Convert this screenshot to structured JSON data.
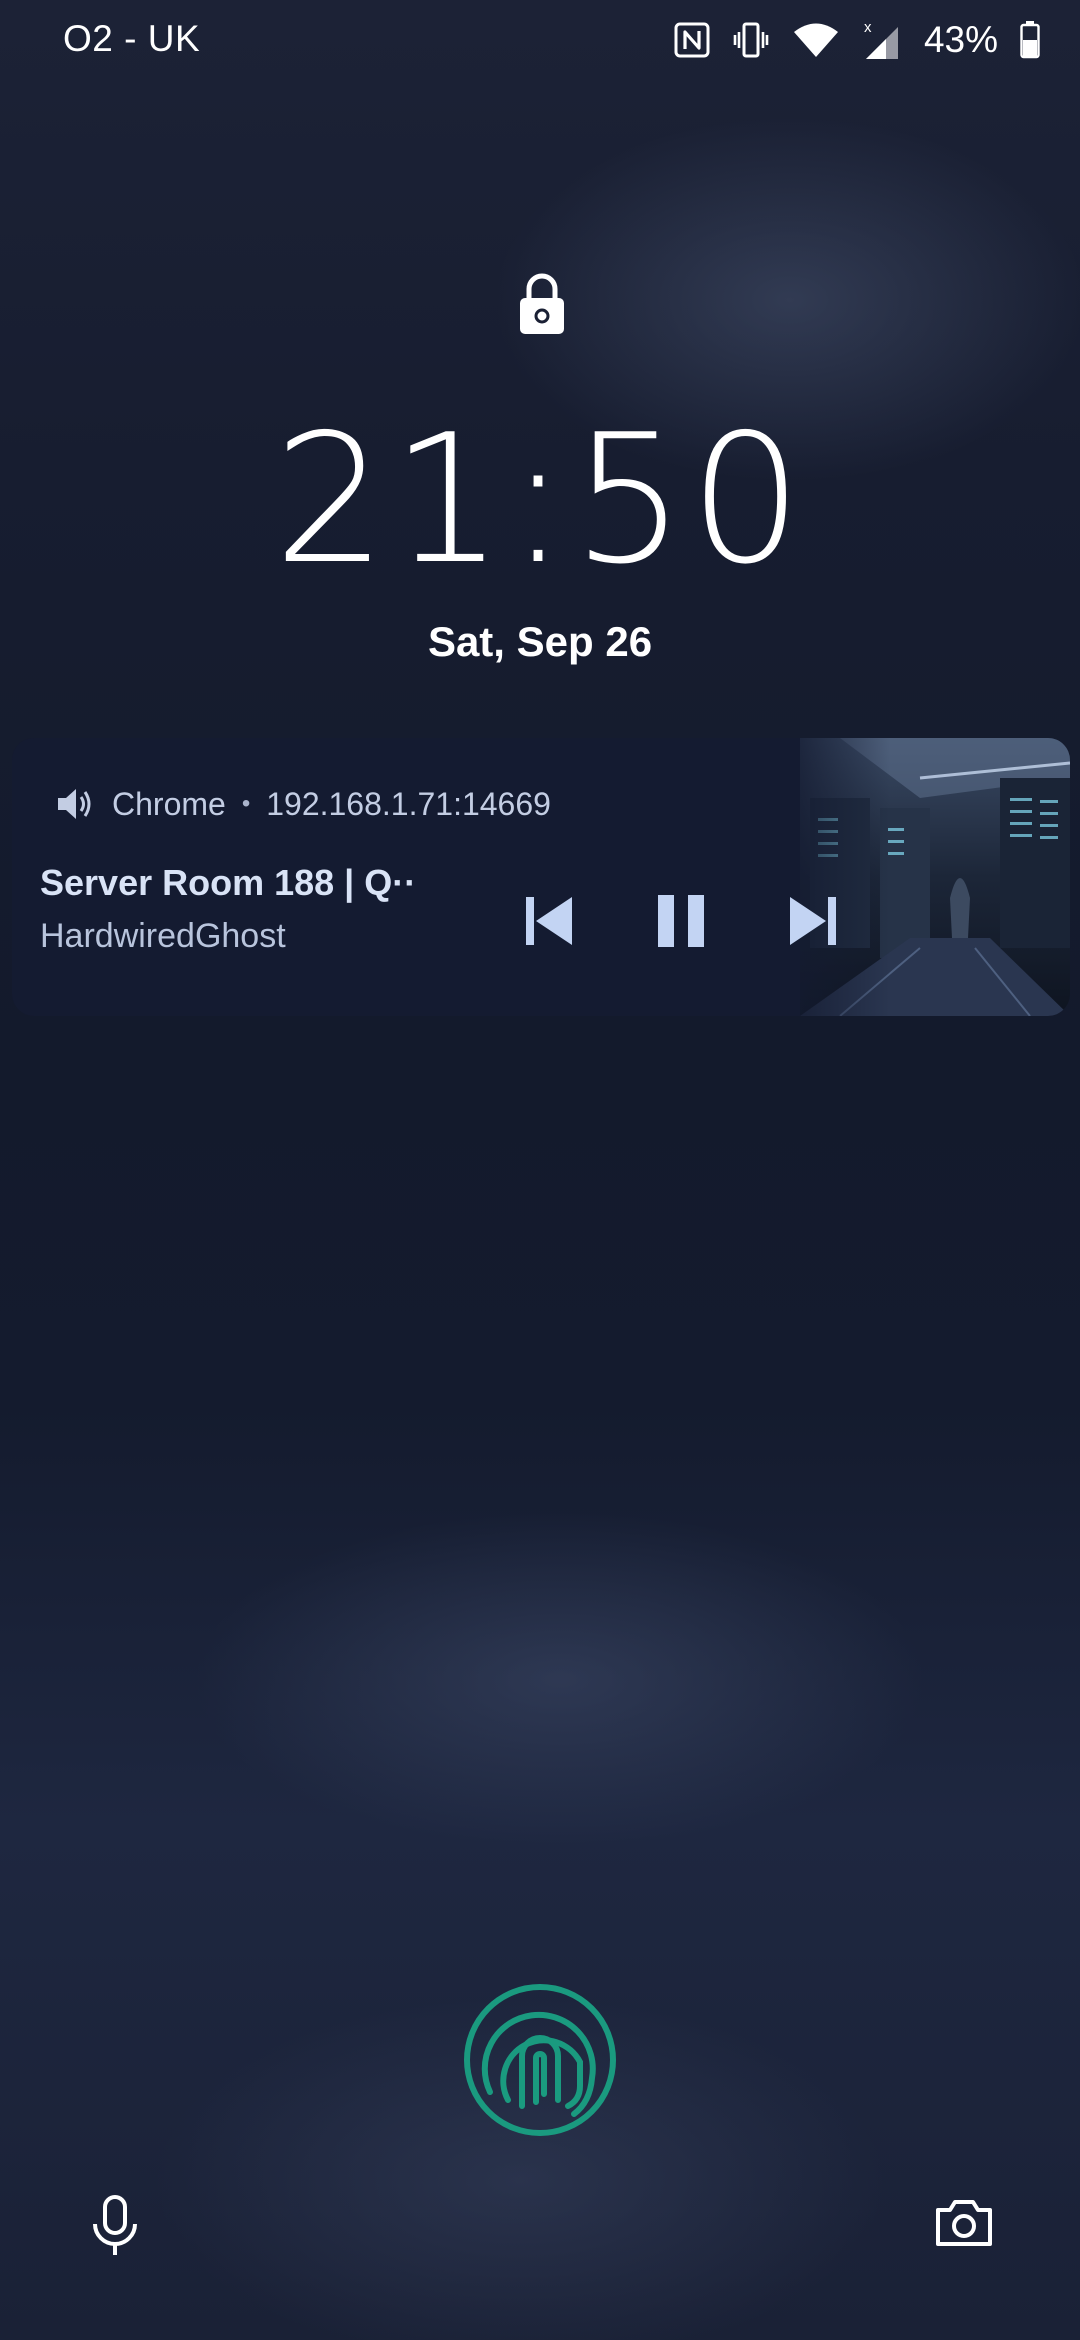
{
  "status_bar": {
    "carrier": "O2 - UK",
    "battery_percent": "43%",
    "icons": [
      "nfc-icon",
      "vibrate-icon",
      "wifi-icon",
      "cell-signal-icon",
      "battery-icon"
    ],
    "signal_badge": "x"
  },
  "lockscreen": {
    "lock_icon": "padlock-icon",
    "time": "21:50",
    "date": "Sat, Sep 26"
  },
  "media": {
    "app_name": "Chrome",
    "separator": "•",
    "source": "192.168.1.71:14669",
    "title": "Server Room 188 | Q··",
    "artist": "HardwiredGhost",
    "controls": [
      "previous",
      "pause",
      "next"
    ],
    "accent_color": "#c3d4f3"
  },
  "bottom": {
    "fingerprint_color": "#1a9a7f",
    "left_shortcut": "microphone-icon",
    "right_shortcut": "camera-icon"
  }
}
